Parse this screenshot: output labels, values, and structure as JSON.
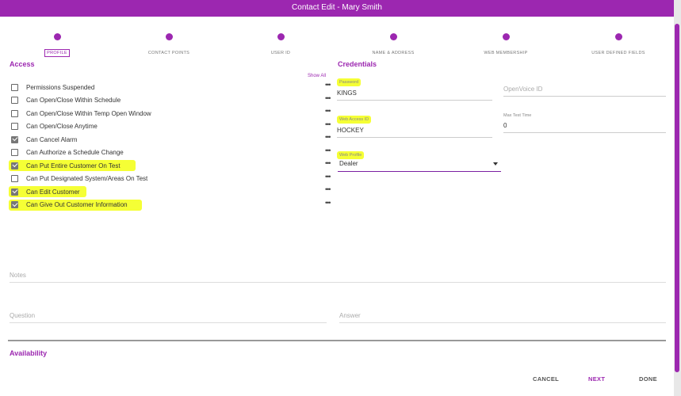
{
  "dialog": {
    "title": "Contact Edit - Mary Smith"
  },
  "stepper": {
    "steps": [
      {
        "label": "PROFILE"
      },
      {
        "label": "CONTACT POINTS"
      },
      {
        "label": "USER ID"
      },
      {
        "label": "NAME & ADDRESS"
      },
      {
        "label": "WEB MEMBERSHIP"
      },
      {
        "label": "USER DEFINED FIELDS"
      }
    ]
  },
  "access": {
    "title": "Access",
    "show_all": "Show All",
    "permissions": [
      {
        "label": "Permissions Suspended",
        "checked": false,
        "highlight": false
      },
      {
        "label": "Can Open/Close Within Schedule",
        "checked": false,
        "highlight": false
      },
      {
        "label": "Can Open/Close Within Temp Open Window",
        "checked": false,
        "highlight": false
      },
      {
        "label": "Can Open/Close Anytime",
        "checked": false,
        "highlight": false
      },
      {
        "label": "Can Cancel Alarm",
        "checked": true,
        "highlight": false
      },
      {
        "label": "Can Authorize a Schedule Change",
        "checked": false,
        "highlight": false
      },
      {
        "label": "Can Put Entire Customer On Test",
        "checked": true,
        "highlight": true
      },
      {
        "label": "Can Put Designated System/Areas On Test",
        "checked": false,
        "highlight": false
      },
      {
        "label": "Can Edit Customer",
        "checked": true,
        "highlight": true
      },
      {
        "label": "Can Give Out Customer Information",
        "checked": true,
        "highlight": true
      }
    ],
    "more_icon": "more-horizontal-icon"
  },
  "credentials": {
    "title": "Credentials",
    "password_label": "Password",
    "password_value": "KINGS",
    "openvoice_placeholder": "OpenVoice ID",
    "web_access_label": "Web Access ID",
    "web_access_value": "HOCKEY",
    "max_test_label": "Max Test Time",
    "max_test_value": "0",
    "web_profile_label": "Web Profile",
    "web_profile_value": "Dealer"
  },
  "notes": {
    "placeholder": "Notes"
  },
  "question": {
    "placeholder": "Question"
  },
  "answer": {
    "placeholder": "Answer"
  },
  "availability": {
    "title": "Availability"
  },
  "footer": {
    "cancel": "CANCEL",
    "next": "NEXT",
    "done": "DONE"
  },
  "colors": {
    "accent": "#9c27b0",
    "highlight": "#f5ff35"
  }
}
